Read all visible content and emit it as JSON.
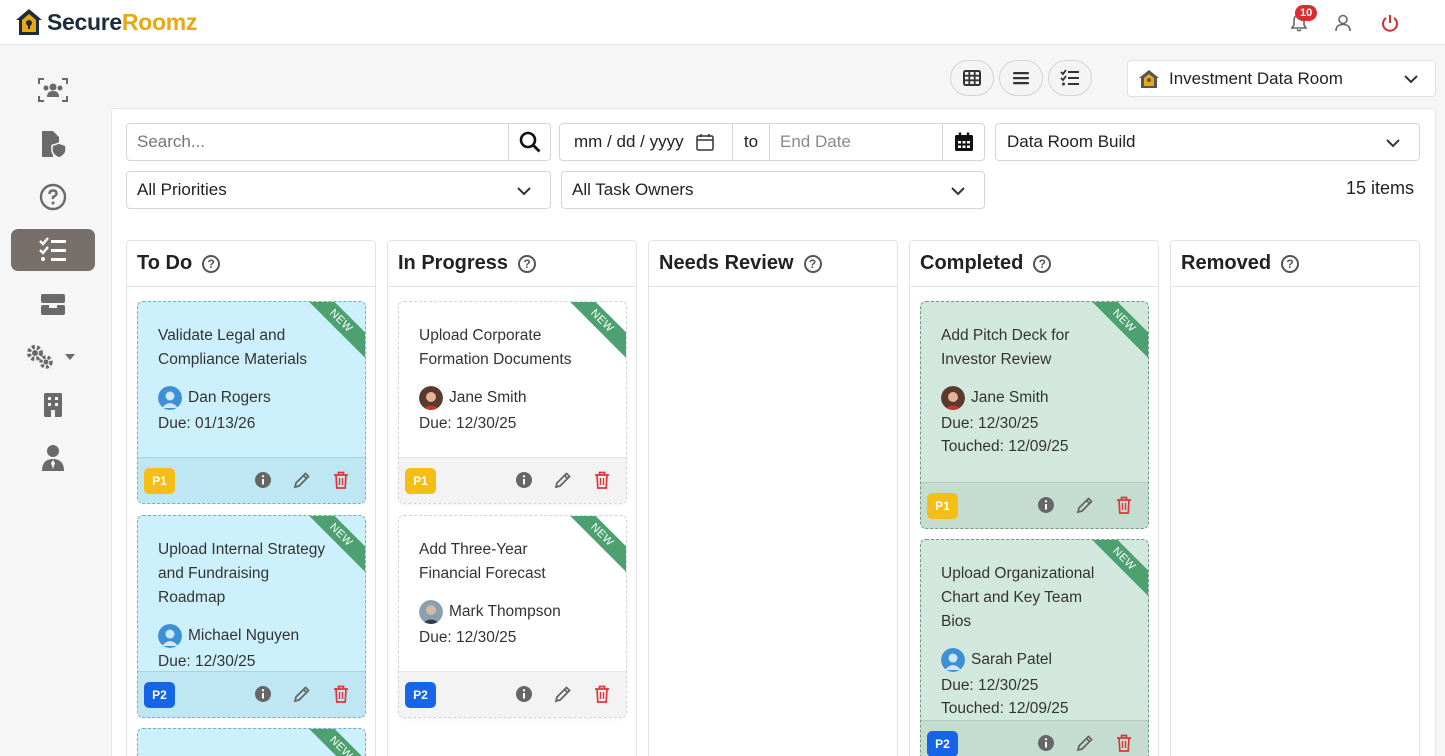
{
  "brand": {
    "part1": "Secure",
    "part2": "Roomz"
  },
  "header": {
    "notification_count": "10"
  },
  "room_selector": {
    "value": "Investment Data Room"
  },
  "filters": {
    "search_placeholder": "Search...",
    "start_date_placeholder": "mm / dd / yyyy",
    "to_label": "to",
    "end_date_placeholder": "End Date",
    "category": "Data Room Build",
    "priority": "All Priorities",
    "owner": "All Task Owners"
  },
  "items_count": "15 items",
  "columns": [
    {
      "title": "To Do"
    },
    {
      "title": "In Progress"
    },
    {
      "title": "Needs Review"
    },
    {
      "title": "Completed"
    },
    {
      "title": "Removed"
    }
  ],
  "cards": {
    "todo": [
      {
        "title": "Validate Legal and Compliance Materials",
        "owner": "Dan Rogers",
        "due": "Due: 01/13/26",
        "priority": "P1",
        "ribbon": "NEW"
      },
      {
        "title": "Upload Internal Strategy and Fundraising Roadmap",
        "owner": "Michael Nguyen",
        "due": "Due: 12/30/25",
        "priority": "P2",
        "ribbon": "NEW"
      },
      {
        "ribbon": "NEW"
      }
    ],
    "progress": [
      {
        "title": "Upload Corporate Formation Documents",
        "owner": "Jane Smith",
        "due": "Due: 12/30/25",
        "priority": "P1",
        "ribbon": "NEW"
      },
      {
        "title": "Add Three-Year Financial Forecast",
        "owner": "Mark Thompson",
        "due": "Due: 12/30/25",
        "priority": "P2",
        "ribbon": "NEW"
      }
    ],
    "completed": [
      {
        "title": "Add Pitch Deck for Investor Review",
        "owner": "Jane Smith",
        "due": "Due: 12/30/25",
        "touched": "Touched: 12/09/25",
        "priority": "P1",
        "ribbon": "NEW"
      },
      {
        "title": "Upload Organizational Chart and Key Team Bios",
        "owner": "Sarah Patel",
        "due": "Due: 12/30/25",
        "touched": "Touched: 12/09/25",
        "priority": "P2",
        "ribbon": "NEW"
      }
    ]
  },
  "colors": {
    "accent": "#e9a80f",
    "p1": "#f5be14",
    "p2": "#1665e8",
    "new_ribbon": "#4da06f",
    "todo_card": "#cdf1fc",
    "completed_card": "#d3e8dc"
  },
  "icons": [
    "team-icon",
    "secure-doc-icon",
    "help-icon",
    "tasks-icon",
    "inbox-icon",
    "settings-icon",
    "building-icon",
    "user-icon",
    "bell-icon",
    "profile-icon",
    "power-icon",
    "grid-view-icon",
    "list-view-icon",
    "task-view-icon",
    "search-icon",
    "calendar-icon",
    "info-icon",
    "edit-icon",
    "delete-icon"
  ]
}
